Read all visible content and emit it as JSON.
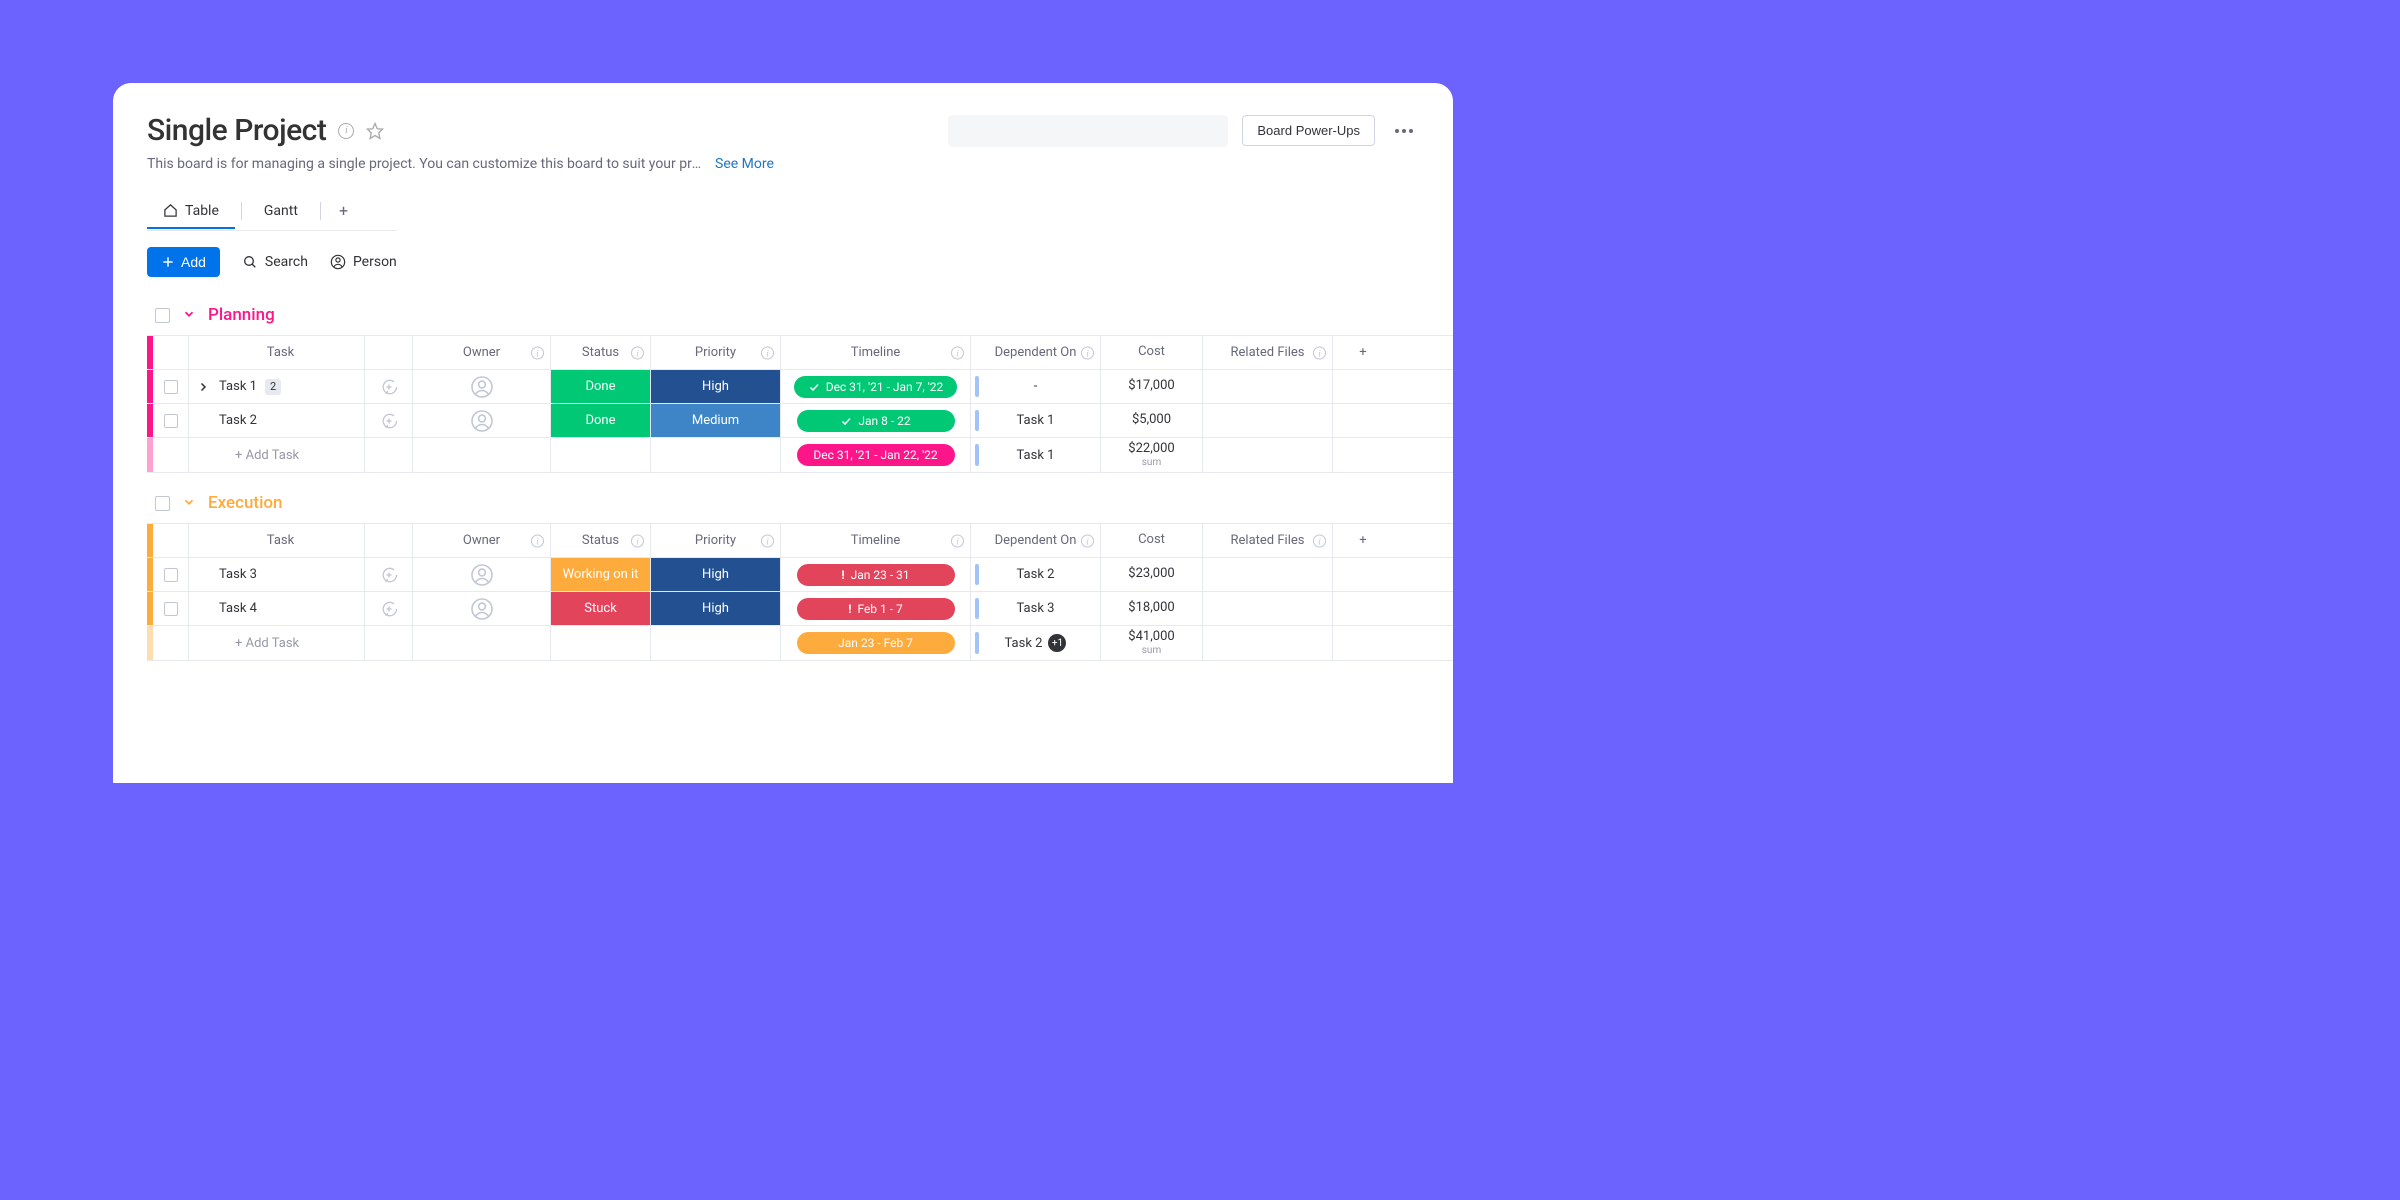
{
  "header": {
    "title": "Single Project",
    "description": "This board is for managing a single project. You can customize this board to suit your project n…",
    "see_more": "See More",
    "powerups": "Board Power-Ups"
  },
  "tabs": {
    "items": [
      "Table",
      "Gantt"
    ],
    "active_index": 0
  },
  "toolbar": {
    "add": "Add",
    "search": "Search",
    "person": "Person"
  },
  "columns": [
    "Task",
    "Owner",
    "Status",
    "Priority",
    "Timeline",
    "Dependent On",
    "Cost",
    "Related Files"
  ],
  "colors": {
    "planning": "#ff158a",
    "execution": "#fdab3d",
    "done": "#00c875",
    "working": "#fdab3d",
    "stuck": "#e2445c",
    "high": "#225091",
    "medium": "#3d85c6",
    "timeline_done": "#00c875",
    "timeline_alert": "#e2445c",
    "timeline_sum_pink": "#ff158a",
    "timeline_sum_orange": "#fdab3d"
  },
  "groups": [
    {
      "name": "Planning",
      "color_key": "planning",
      "rows": [
        {
          "task": "Task 1",
          "subitems": "2",
          "has_expand": true,
          "status": {
            "label": "Done",
            "color_key": "done"
          },
          "priority": {
            "label": "High",
            "color_key": "high"
          },
          "timeline": {
            "label": "Dec 31, '21 - Jan 7, '22",
            "color_key": "timeline_done",
            "icon": "check"
          },
          "dependent": "-",
          "cost": "$17,000"
        },
        {
          "task": "Task 2",
          "status": {
            "label": "Done",
            "color_key": "done"
          },
          "priority": {
            "label": "Medium",
            "color_key": "medium"
          },
          "timeline": {
            "label": "Jan 8 - 22",
            "color_key": "timeline_done",
            "icon": "check"
          },
          "dependent": "Task 1",
          "cost": "$5,000"
        }
      ],
      "summary": {
        "add_task": "+ Add Task",
        "timeline": {
          "label": "Dec 31, '21 - Jan 22, '22",
          "color_key": "timeline_sum_pink"
        },
        "dependent": "Task 1",
        "cost": "$22,000",
        "cost_sub": "sum"
      }
    },
    {
      "name": "Execution",
      "color_key": "execution",
      "rows": [
        {
          "task": "Task 3",
          "status": {
            "label": "Working on it",
            "color_key": "working"
          },
          "priority": {
            "label": "High",
            "color_key": "high"
          },
          "timeline": {
            "label": "Jan 23 - 31",
            "color_key": "timeline_alert",
            "icon": "alert"
          },
          "dependent": "Task 2",
          "cost": "$23,000"
        },
        {
          "task": "Task 4",
          "status": {
            "label": "Stuck",
            "color_key": "stuck"
          },
          "priority": {
            "label": "High",
            "color_key": "high"
          },
          "timeline": {
            "label": "Feb 1 - 7",
            "color_key": "timeline_alert",
            "icon": "alert"
          },
          "dependent": "Task 3",
          "cost": "$18,000"
        }
      ],
      "summary": {
        "add_task": "+ Add Task",
        "timeline": {
          "label": "Jan 23 - Feb 7",
          "color_key": "timeline_sum_orange"
        },
        "dependent": "Task 2",
        "dependent_extra": "+1",
        "cost": "$41,000",
        "cost_sub": "sum"
      }
    }
  ]
}
